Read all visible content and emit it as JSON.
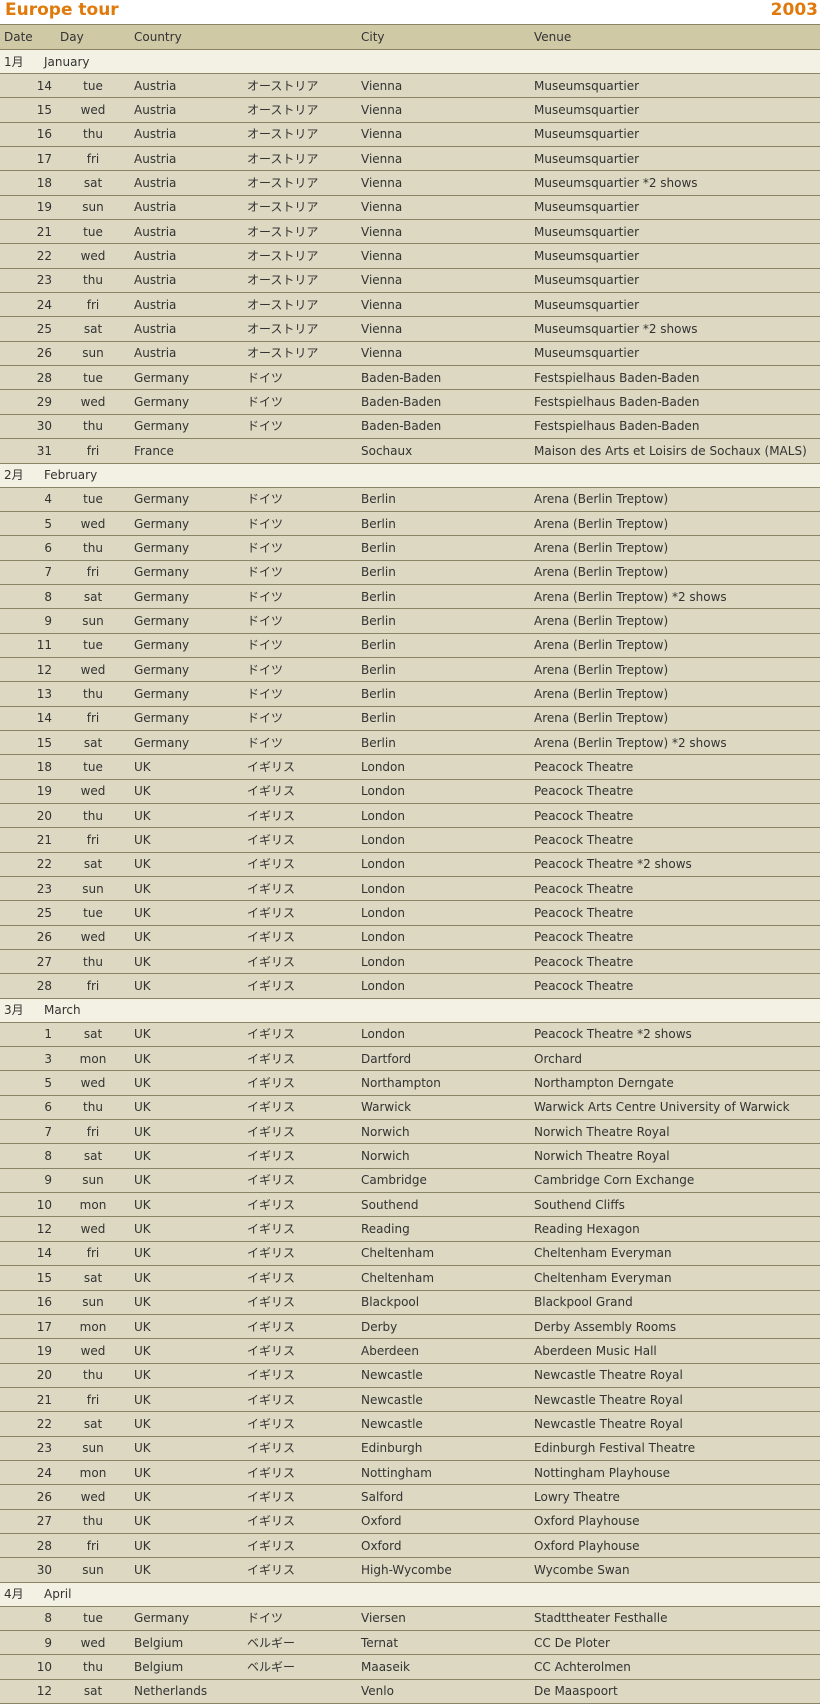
{
  "title": "Europe tour",
  "year": "2003",
  "colors": {
    "accent": "#e07a0b",
    "header_bg": "#cfc9a6",
    "row_bg": "#dcd8c1",
    "month_bg": "#f2f1e3"
  },
  "headers": {
    "date": "Date",
    "day": "Day",
    "country": "Country",
    "city": "City",
    "venue": "Venue"
  },
  "months": [
    {
      "num": "1月",
      "name": "January",
      "rows": [
        {
          "date": "14",
          "day": "tue",
          "country": "Austria",
          "jp": "オーストリア",
          "city": "Vienna",
          "venue": "Museumsquartier"
        },
        {
          "date": "15",
          "day": "wed",
          "country": "Austria",
          "jp": "オーストリア",
          "city": "Vienna",
          "venue": "Museumsquartier"
        },
        {
          "date": "16",
          "day": "thu",
          "country": "Austria",
          "jp": "オーストリア",
          "city": "Vienna",
          "venue": "Museumsquartier"
        },
        {
          "date": "17",
          "day": "fri",
          "country": "Austria",
          "jp": "オーストリア",
          "city": "Vienna",
          "venue": "Museumsquartier"
        },
        {
          "date": "18",
          "day": "sat",
          "country": "Austria",
          "jp": "オーストリア",
          "city": "Vienna",
          "venue": "Museumsquartier *2 shows"
        },
        {
          "date": "19",
          "day": "sun",
          "country": "Austria",
          "jp": "オーストリア",
          "city": "Vienna",
          "venue": "Museumsquartier"
        },
        {
          "date": "21",
          "day": "tue",
          "country": "Austria",
          "jp": "オーストリア",
          "city": "Vienna",
          "venue": "Museumsquartier"
        },
        {
          "date": "22",
          "day": "wed",
          "country": "Austria",
          "jp": "オーストリア",
          "city": "Vienna",
          "venue": "Museumsquartier"
        },
        {
          "date": "23",
          "day": "thu",
          "country": "Austria",
          "jp": "オーストリア",
          "city": "Vienna",
          "venue": "Museumsquartier"
        },
        {
          "date": "24",
          "day": "fri",
          "country": "Austria",
          "jp": "オーストリア",
          "city": "Vienna",
          "venue": "Museumsquartier"
        },
        {
          "date": "25",
          "day": "sat",
          "country": "Austria",
          "jp": "オーストリア",
          "city": "Vienna",
          "venue": "Museumsquartier *2 shows"
        },
        {
          "date": "26",
          "day": "sun",
          "country": "Austria",
          "jp": "オーストリア",
          "city": "Vienna",
          "venue": "Museumsquartier"
        },
        {
          "date": "28",
          "day": "tue",
          "country": "Germany",
          "jp": "ドイツ",
          "city": "Baden-Baden",
          "venue": "Festspielhaus Baden-Baden"
        },
        {
          "date": "29",
          "day": "wed",
          "country": "Germany",
          "jp": "ドイツ",
          "city": "Baden-Baden",
          "venue": "Festspielhaus Baden-Baden"
        },
        {
          "date": "30",
          "day": "thu",
          "country": "Germany",
          "jp": "ドイツ",
          "city": "Baden-Baden",
          "venue": "Festspielhaus Baden-Baden"
        },
        {
          "date": "31",
          "day": "fri",
          "country": "France",
          "jp": "",
          "city": "Sochaux",
          "venue": "Maison des Arts et Loisirs de Sochaux (MALS)"
        }
      ]
    },
    {
      "num": "2月",
      "name": "February",
      "rows": [
        {
          "date": "4",
          "day": "tue",
          "country": "Germany",
          "jp": "ドイツ",
          "city": "Berlin",
          "venue": "Arena (Berlin Treptow)"
        },
        {
          "date": "5",
          "day": "wed",
          "country": "Germany",
          "jp": "ドイツ",
          "city": "Berlin",
          "venue": "Arena (Berlin Treptow)"
        },
        {
          "date": "6",
          "day": "thu",
          "country": "Germany",
          "jp": "ドイツ",
          "city": "Berlin",
          "venue": "Arena (Berlin Treptow)"
        },
        {
          "date": "7",
          "day": "fri",
          "country": "Germany",
          "jp": "ドイツ",
          "city": "Berlin",
          "venue": "Arena (Berlin Treptow)"
        },
        {
          "date": "8",
          "day": "sat",
          "country": "Germany",
          "jp": "ドイツ",
          "city": "Berlin",
          "venue": "Arena (Berlin Treptow) *2 shows"
        },
        {
          "date": "9",
          "day": "sun",
          "country": "Germany",
          "jp": "ドイツ",
          "city": "Berlin",
          "venue": "Arena (Berlin Treptow)"
        },
        {
          "date": "11",
          "day": "tue",
          "country": "Germany",
          "jp": "ドイツ",
          "city": "Berlin",
          "venue": "Arena (Berlin Treptow)"
        },
        {
          "date": "12",
          "day": "wed",
          "country": "Germany",
          "jp": "ドイツ",
          "city": "Berlin",
          "venue": "Arena (Berlin Treptow)"
        },
        {
          "date": "13",
          "day": "thu",
          "country": "Germany",
          "jp": "ドイツ",
          "city": "Berlin",
          "venue": "Arena (Berlin Treptow)"
        },
        {
          "date": "14",
          "day": "fri",
          "country": "Germany",
          "jp": "ドイツ",
          "city": "Berlin",
          "venue": "Arena (Berlin Treptow)"
        },
        {
          "date": "15",
          "day": "sat",
          "country": "Germany",
          "jp": "ドイツ",
          "city": "Berlin",
          "venue": "Arena (Berlin Treptow) *2 shows"
        },
        {
          "date": "18",
          "day": "tue",
          "country": "UK",
          "jp": "イギリス",
          "city": "London",
          "venue": "Peacock Theatre"
        },
        {
          "date": "19",
          "day": "wed",
          "country": "UK",
          "jp": "イギリス",
          "city": "London",
          "venue": "Peacock Theatre"
        },
        {
          "date": "20",
          "day": "thu",
          "country": "UK",
          "jp": "イギリス",
          "city": "London",
          "venue": "Peacock Theatre"
        },
        {
          "date": "21",
          "day": "fri",
          "country": "UK",
          "jp": "イギリス",
          "city": "London",
          "venue": "Peacock Theatre"
        },
        {
          "date": "22",
          "day": "sat",
          "country": "UK",
          "jp": "イギリス",
          "city": "London",
          "venue": "Peacock Theatre *2 shows"
        },
        {
          "date": "23",
          "day": "sun",
          "country": "UK",
          "jp": "イギリス",
          "city": "London",
          "venue": "Peacock Theatre"
        },
        {
          "date": "25",
          "day": "tue",
          "country": "UK",
          "jp": "イギリス",
          "city": "London",
          "venue": "Peacock Theatre"
        },
        {
          "date": "26",
          "day": "wed",
          "country": "UK",
          "jp": "イギリス",
          "city": "London",
          "venue": "Peacock Theatre"
        },
        {
          "date": "27",
          "day": "thu",
          "country": "UK",
          "jp": "イギリス",
          "city": "London",
          "venue": "Peacock Theatre"
        },
        {
          "date": "28",
          "day": "fri",
          "country": "UK",
          "jp": "イギリス",
          "city": "London",
          "venue": "Peacock Theatre"
        }
      ]
    },
    {
      "num": "3月",
      "name": "March",
      "rows": [
        {
          "date": "1",
          "day": "sat",
          "country": "UK",
          "jp": "イギリス",
          "city": "London",
          "venue": "Peacock Theatre *2 shows"
        },
        {
          "date": "3",
          "day": "mon",
          "country": "UK",
          "jp": "イギリス",
          "city": "Dartford",
          "venue": "Orchard"
        },
        {
          "date": "5",
          "day": "wed",
          "country": "UK",
          "jp": "イギリス",
          "city": "Northampton",
          "venue": "Northampton Derngate"
        },
        {
          "date": "6",
          "day": "thu",
          "country": "UK",
          "jp": "イギリス",
          "city": "Warwick",
          "venue": "Warwick Arts Centre University of Warwick"
        },
        {
          "date": "7",
          "day": "fri",
          "country": "UK",
          "jp": "イギリス",
          "city": "Norwich",
          "venue": "Norwich Theatre Royal"
        },
        {
          "date": "8",
          "day": "sat",
          "country": "UK",
          "jp": "イギリス",
          "city": "Norwich",
          "venue": "Norwich Theatre Royal"
        },
        {
          "date": "9",
          "day": "sun",
          "country": "UK",
          "jp": "イギリス",
          "city": "Cambridge",
          "venue": "Cambridge Corn Exchange"
        },
        {
          "date": "10",
          "day": "mon",
          "country": "UK",
          "jp": "イギリス",
          "city": "Southend",
          "venue": "Southend Cliffs"
        },
        {
          "date": "12",
          "day": "wed",
          "country": "UK",
          "jp": "イギリス",
          "city": "Reading",
          "venue": "Reading Hexagon"
        },
        {
          "date": "14",
          "day": "fri",
          "country": "UK",
          "jp": "イギリス",
          "city": "Cheltenham",
          "venue": "Cheltenham Everyman"
        },
        {
          "date": "15",
          "day": "sat",
          "country": "UK",
          "jp": "イギリス",
          "city": "Cheltenham",
          "venue": "Cheltenham Everyman"
        },
        {
          "date": "16",
          "day": "sun",
          "country": "UK",
          "jp": "イギリス",
          "city": "Blackpool",
          "venue": "Blackpool Grand"
        },
        {
          "date": "17",
          "day": "mon",
          "country": "UK",
          "jp": "イギリス",
          "city": "Derby",
          "venue": "Derby Assembly Rooms"
        },
        {
          "date": "19",
          "day": "wed",
          "country": "UK",
          "jp": "イギリス",
          "city": "Aberdeen",
          "venue": "Aberdeen Music Hall"
        },
        {
          "date": "20",
          "day": "thu",
          "country": "UK",
          "jp": "イギリス",
          "city": "Newcastle",
          "venue": "Newcastle Theatre Royal"
        },
        {
          "date": "21",
          "day": "fri",
          "country": "UK",
          "jp": "イギリス",
          "city": "Newcastle",
          "venue": "Newcastle Theatre Royal"
        },
        {
          "date": "22",
          "day": "sat",
          "country": "UK",
          "jp": "イギリス",
          "city": "Newcastle",
          "venue": "Newcastle Theatre Royal"
        },
        {
          "date": "23",
          "day": "sun",
          "country": "UK",
          "jp": "イギリス",
          "city": "Edinburgh",
          "venue": "Edinburgh Festival Theatre"
        },
        {
          "date": "24",
          "day": "mon",
          "country": "UK",
          "jp": "イギリス",
          "city": "Nottingham",
          "venue": "Nottingham Playhouse"
        },
        {
          "date": "26",
          "day": "wed",
          "country": "UK",
          "jp": "イギリス",
          "city": "Salford",
          "venue": "Lowry Theatre"
        },
        {
          "date": "27",
          "day": "thu",
          "country": "UK",
          "jp": "イギリス",
          "city": "Oxford",
          "venue": "Oxford Playhouse"
        },
        {
          "date": "28",
          "day": "fri",
          "country": "UK",
          "jp": "イギリス",
          "city": "Oxford",
          "venue": "Oxford Playhouse"
        },
        {
          "date": "30",
          "day": "sun",
          "country": "UK",
          "jp": "イギリス",
          "city": "High-Wycombe",
          "venue": "Wycombe Swan"
        }
      ]
    },
    {
      "num": "4月",
      "name": "April",
      "rows": [
        {
          "date": "8",
          "day": "tue",
          "country": "Germany",
          "jp": "ドイツ",
          "city": "Viersen",
          "venue": "Stadttheater Festhalle"
        },
        {
          "date": "9",
          "day": "wed",
          "country": "Belgium",
          "jp": "ベルギー",
          "city": "Ternat",
          "venue": "CC De Ploter"
        },
        {
          "date": "10",
          "day": "thu",
          "country": "Belgium",
          "jp": "ベルギー",
          "city": "Maaseik",
          "venue": "CC Achterolmen"
        },
        {
          "date": "12",
          "day": "sat",
          "country": "Netherlands",
          "jp": "",
          "city": "Venlo",
          "venue": "De Maaspoort"
        }
      ]
    }
  ]
}
